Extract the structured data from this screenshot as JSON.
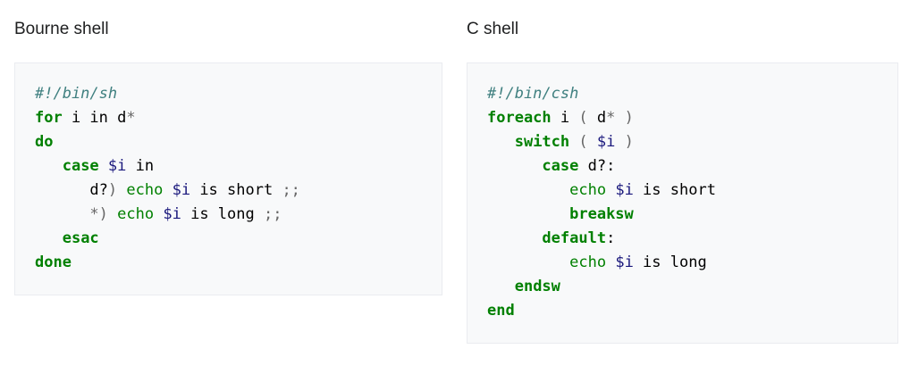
{
  "left": {
    "heading": "Bourne shell",
    "lines": [
      [
        [
          "comment",
          "#!/bin/sh"
        ]
      ],
      [
        [
          "keyword",
          "for"
        ],
        [
          "text",
          " i in d"
        ],
        [
          "operator",
          "*"
        ]
      ],
      [
        [
          "keyword",
          "do"
        ]
      ],
      [
        [
          "text",
          "   "
        ],
        [
          "keyword",
          "case"
        ],
        [
          "text",
          " "
        ],
        [
          "variable",
          "$i"
        ],
        [
          "text",
          " in"
        ]
      ],
      [
        [
          "text",
          "      d?"
        ],
        [
          "operator",
          ")"
        ],
        [
          "text",
          " "
        ],
        [
          "builtin",
          "echo"
        ],
        [
          "text",
          " "
        ],
        [
          "variable",
          "$i"
        ],
        [
          "text",
          " is short "
        ],
        [
          "operator",
          ";;"
        ]
      ],
      [
        [
          "text",
          "      "
        ],
        [
          "operator",
          "*)"
        ],
        [
          "text",
          " "
        ],
        [
          "builtin",
          "echo"
        ],
        [
          "text",
          " "
        ],
        [
          "variable",
          "$i"
        ],
        [
          "text",
          " is long "
        ],
        [
          "operator",
          ";;"
        ]
      ],
      [
        [
          "text",
          "   "
        ],
        [
          "keyword",
          "esac"
        ]
      ],
      [
        [
          "keyword",
          "done"
        ]
      ]
    ]
  },
  "right": {
    "heading": "C shell",
    "lines": [
      [
        [
          "comment",
          "#!/bin/csh"
        ]
      ],
      [
        [
          "keyword",
          "foreach"
        ],
        [
          "text",
          " i "
        ],
        [
          "operator",
          "("
        ],
        [
          "text",
          " d"
        ],
        [
          "operator",
          "*"
        ],
        [
          "text",
          " "
        ],
        [
          "operator",
          ")"
        ]
      ],
      [
        [
          "text",
          "   "
        ],
        [
          "keyword",
          "switch"
        ],
        [
          "text",
          " "
        ],
        [
          "operator",
          "("
        ],
        [
          "text",
          " "
        ],
        [
          "variable",
          "$i"
        ],
        [
          "text",
          " "
        ],
        [
          "operator",
          ")"
        ]
      ],
      [
        [
          "text",
          "      "
        ],
        [
          "keyword",
          "case"
        ],
        [
          "text",
          " d?:"
        ]
      ],
      [
        [
          "text",
          "         "
        ],
        [
          "builtin",
          "echo"
        ],
        [
          "text",
          " "
        ],
        [
          "variable",
          "$i"
        ],
        [
          "text",
          " is short"
        ]
      ],
      [
        [
          "text",
          "         "
        ],
        [
          "keyword",
          "breaksw"
        ]
      ],
      [
        [
          "text",
          "      "
        ],
        [
          "keyword",
          "default"
        ],
        [
          "text",
          ":"
        ]
      ],
      [
        [
          "text",
          "         "
        ],
        [
          "builtin",
          "echo"
        ],
        [
          "text",
          " "
        ],
        [
          "variable",
          "$i"
        ],
        [
          "text",
          " is long"
        ]
      ],
      [
        [
          "text",
          "   "
        ],
        [
          "keyword",
          "endsw"
        ]
      ],
      [
        [
          "keyword",
          "end"
        ]
      ]
    ]
  }
}
